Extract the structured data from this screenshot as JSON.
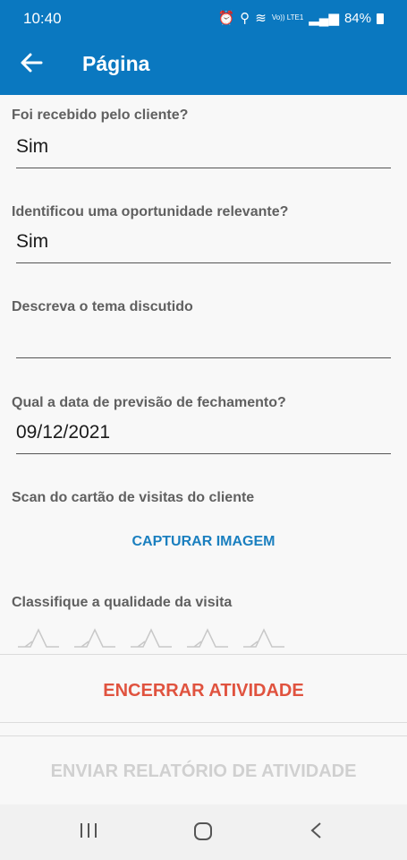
{
  "status_bar": {
    "time": "10:40",
    "network": "Vo)) LTE1",
    "battery": "84%"
  },
  "app_bar": {
    "title": "Página"
  },
  "form": {
    "q1": {
      "label": "Foi recebido pelo cliente?",
      "value": "Sim"
    },
    "q2": {
      "label": "Identificou uma oportunidade relevante?",
      "value": "Sim"
    },
    "q3": {
      "label": "Descreva o tema discutido",
      "value": ""
    },
    "q4": {
      "label": "Qual a data de previsão de fechamento?",
      "value": "09/12/2021"
    },
    "scan": {
      "label": "Scan do cartão de visitas do cliente",
      "button": "CAPTURAR IMAGEM"
    },
    "rating": {
      "label": "Classifique a qualidade da visita",
      "max": 5,
      "value": 0
    }
  },
  "actions": {
    "close_activity": "ENCERRAR ATIVIDADE",
    "send_report": "ENVIAR RELATÓRIO DE ATIVIDADE"
  },
  "colors": {
    "primary": "#0a78c0",
    "link": "#1a7fbf",
    "danger": "#e0533f",
    "disabled": "#d0d0d0"
  },
  "icons": {
    "back": "arrow-left-icon",
    "star": "star-outline-icon",
    "nav_recent": "recent-apps-icon",
    "nav_home": "home-icon",
    "nav_back": "back-chevron-icon"
  }
}
